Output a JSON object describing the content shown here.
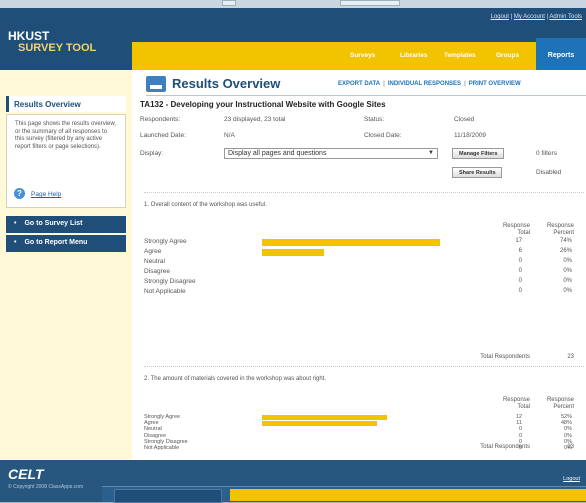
{
  "header": {
    "top_links": [
      "Logout",
      "My Account",
      "Admin Tools"
    ],
    "logo_line1": "HKUST",
    "logo_line2": "SURVEY TOOL",
    "nav": [
      "Surveys",
      "Libraries",
      "Templates",
      "Groups"
    ],
    "active_nav": "Reports"
  },
  "sidebar": {
    "title": "Results Overview",
    "description": "This page shows the results overview, or the summary of all responses to this survey (filtered by any active report filters or page selections).",
    "help_link": "Page Help",
    "buttons": [
      "Go to Survey List",
      "Go to Report Menu"
    ]
  },
  "main": {
    "title": "Results Overview",
    "actions": [
      "EXPORT DATA",
      "INDIVIDUAL RESPONSES",
      "PRINT OVERVIEW"
    ],
    "survey_title": "TA132 - Developing your Instructional Website with Google Sites",
    "respondents_label": "Respondents:",
    "respondents_value": "23 displayed, 23 total",
    "status_label": "Status:",
    "status_value": "Closed",
    "launched_label": "Launched Date:",
    "launched_value": "N/A",
    "closed_label": "Closed Date:",
    "closed_value": "11/18/2009",
    "display_label": "Display:",
    "display_value": "Display all pages and questions",
    "manage_filters": "Manage Filters",
    "filters_count": "0 filters",
    "share_results": "Share Results",
    "share_status": "Disabled"
  },
  "table_headers": {
    "total_line1": "Response",
    "total_line2": "Total",
    "percent_line1": "Response",
    "percent_line2": "Percent",
    "total_respondents": "Total Respondents"
  },
  "questions": [
    {
      "text": "1.  Overall content of the workshop was useful.",
      "rows": [
        {
          "label": "Strongly Agree",
          "total": "17",
          "percent": "74%",
          "fraction": 0.74
        },
        {
          "label": "Agree",
          "total": "6",
          "percent": "26%",
          "fraction": 0.26
        },
        {
          "label": "Neutral",
          "total": "0",
          "percent": "0%",
          "fraction": 0
        },
        {
          "label": "Disagree",
          "total": "0",
          "percent": "0%",
          "fraction": 0
        },
        {
          "label": "Strongly Disagree",
          "total": "0",
          "percent": "0%",
          "fraction": 0
        },
        {
          "label": "Not Applicable",
          "total": "0",
          "percent": "0%",
          "fraction": 0
        }
      ],
      "total_respondents": "23"
    },
    {
      "text": "2.  The amount of materials covered in the workshop was about right.",
      "rows": [
        {
          "label": "Strongly Agree",
          "total": "12",
          "percent": "52%",
          "fraction": 0.52
        },
        {
          "label": "Agree",
          "total": "11",
          "percent": "48%",
          "fraction": 0.48
        },
        {
          "label": "Neutral",
          "total": "0",
          "percent": "0%",
          "fraction": 0
        },
        {
          "label": "Disagree",
          "total": "0",
          "percent": "0%",
          "fraction": 0
        },
        {
          "label": "Strongly Disagree",
          "total": "0",
          "percent": "0%",
          "fraction": 0
        },
        {
          "label": "Not Applicable",
          "total": "0",
          "percent": "0%",
          "fraction": 0
        }
      ],
      "total_respondents": "23"
    }
  ],
  "footer": {
    "logo": "CELT",
    "copyright": "© Copyright 2008 ClassApps.com",
    "logout": "Logout"
  },
  "colors": {
    "header": "#1f4e79",
    "nav_yellow": "#f2c400",
    "active_tab": "#1e73b8",
    "sidebar_bg": "#fff9d8",
    "bar": "#f2c400"
  }
}
